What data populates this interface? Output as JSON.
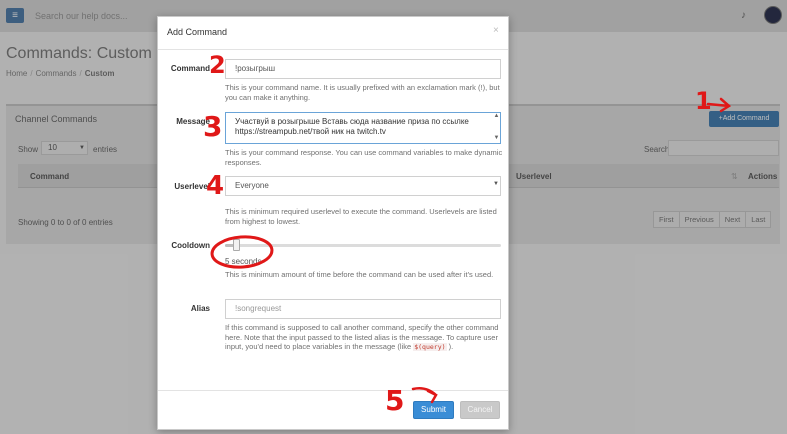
{
  "topbar": {
    "menu_icon": "≡",
    "search_placeholder": "Search our help docs...",
    "bell_icon": "♪"
  },
  "page": {
    "title": "Commands: Custom",
    "breadcrumb": [
      "Home",
      "Commands",
      "Custom"
    ],
    "breadcrumb_separator": "/"
  },
  "panel": {
    "title": "Channel Commands",
    "add_button": "+Add Command",
    "show_label": "Show",
    "show_value": "10",
    "entries_label": "entries",
    "search_label": "Search:",
    "columns": [
      "Command",
      "Userlevel",
      "Actions"
    ],
    "sort_icon": "⇅",
    "info": "Showing 0 to 0 of 0 entries",
    "pager": [
      "First",
      "Previous",
      "Next",
      "Last"
    ]
  },
  "modal": {
    "title": "Add Command",
    "close_icon": "×",
    "command": {
      "label": "Command",
      "value": "!розыгрыш",
      "help": "This is your command name. It is usually prefixed with an exclamation mark (!), but you can make it anything."
    },
    "message": {
      "label": "Message",
      "value": "Участвуй в розыгрыше Вставь сюда название приза по ссылке https://streampub.net/твой ник на twitch.tv",
      "help": "This is your command response. You can use command variables to make dynamic responses."
    },
    "userlevel": {
      "label": "Userlevel",
      "value": "Everyone",
      "help": "This is minimum required userlevel to execute the command. Userlevels are listed from highest to lowest."
    },
    "cooldown": {
      "label": "Cooldown",
      "value_text": "5 seconds",
      "fraction": 0.04,
      "help": "This is minimum amount of time before the command can be used after it's used."
    },
    "alias": {
      "label": "Alias",
      "placeholder": "!songrequest",
      "help_before": "If this command is supposed to call another command, specify the other command here. Note that the input passed to the listed alias is the message. To capture user input, you'd need to place variables in the message (like",
      "help_code": "$(query)",
      "help_after": ")."
    },
    "submit_label": "Submit",
    "cancel_label": "Cancel"
  },
  "annotations": {
    "n1": "1",
    "n2": "2",
    "n3": "3",
    "n4": "4",
    "n5": "5"
  },
  "colors": {
    "primary": "#3a8dd6",
    "annotation": "#e01818"
  }
}
